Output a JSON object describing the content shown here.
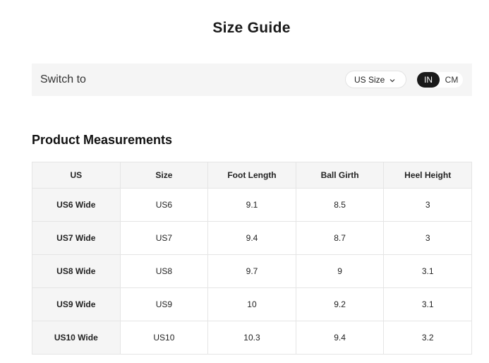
{
  "page": {
    "title": "Size Guide"
  },
  "switch_bar": {
    "label": "Switch to",
    "size_select": "US Size",
    "units": [
      {
        "label": "IN",
        "active": true
      },
      {
        "label": "CM",
        "active": false
      }
    ]
  },
  "section": {
    "title": "Product Measurements"
  },
  "table": {
    "headers": [
      "US",
      "Size",
      "Foot Length",
      "Ball Girth",
      "Heel Height"
    ],
    "rows": [
      [
        "US6 Wide",
        "US6",
        "9.1",
        "8.5",
        "3"
      ],
      [
        "US7 Wide",
        "US7",
        "9.4",
        "8.7",
        "3"
      ],
      [
        "US8 Wide",
        "US8",
        "9.7",
        "9",
        "3.1"
      ],
      [
        "US9 Wide",
        "US9",
        "10",
        "9.2",
        "3.1"
      ],
      [
        "US10 Wide",
        "US10",
        "10.3",
        "9.4",
        "3.2"
      ]
    ]
  },
  "colors": {
    "active_toggle": "#1a1a1a",
    "panel_background": "#f5f5f5",
    "border": "#e5e5e5"
  }
}
